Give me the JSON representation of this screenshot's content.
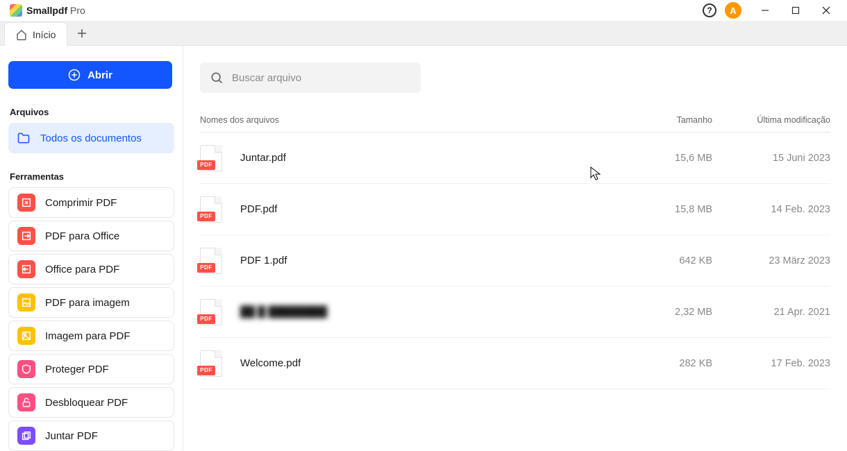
{
  "app": {
    "name": "Smallpdf",
    "edition": "Pro"
  },
  "avatar_letter": "A",
  "tabs": {
    "home": "Início"
  },
  "sidebar": {
    "open_label": "Abrir",
    "section_files": "Arquivos",
    "all_docs": "Todos os documentos",
    "section_tools": "Ferramentas",
    "tools": [
      {
        "label": "Comprimir PDF"
      },
      {
        "label": "PDF para Office"
      },
      {
        "label": "Office para PDF"
      },
      {
        "label": "PDF para imagem"
      },
      {
        "label": "Imagem para PDF"
      },
      {
        "label": "Proteger PDF"
      },
      {
        "label": "Desbloquear PDF"
      },
      {
        "label": "Juntar PDF"
      }
    ]
  },
  "search": {
    "placeholder": "Buscar arquivo"
  },
  "table": {
    "headers": {
      "name": "Nomes dos arquivos",
      "size": "Tamanho",
      "modified": "Última modificação"
    },
    "file_badge": "PDF",
    "rows": [
      {
        "name": "Juntar.pdf",
        "size": "15,6 MB",
        "modified": "15 Juni 2023",
        "blur": false
      },
      {
        "name": "PDF.pdf",
        "size": "15,8 MB",
        "modified": "14 Feb. 2023",
        "blur": false
      },
      {
        "name": "PDF 1.pdf",
        "size": "642 KB",
        "modified": "23 März 2023",
        "blur": false
      },
      {
        "name": "██ █ ████████",
        "size": "2,32 MB",
        "modified": "21 Apr. 2021",
        "blur": true
      },
      {
        "name": "Welcome.pdf",
        "size": "282 KB",
        "modified": "17 Feb. 2023",
        "blur": false
      }
    ]
  }
}
